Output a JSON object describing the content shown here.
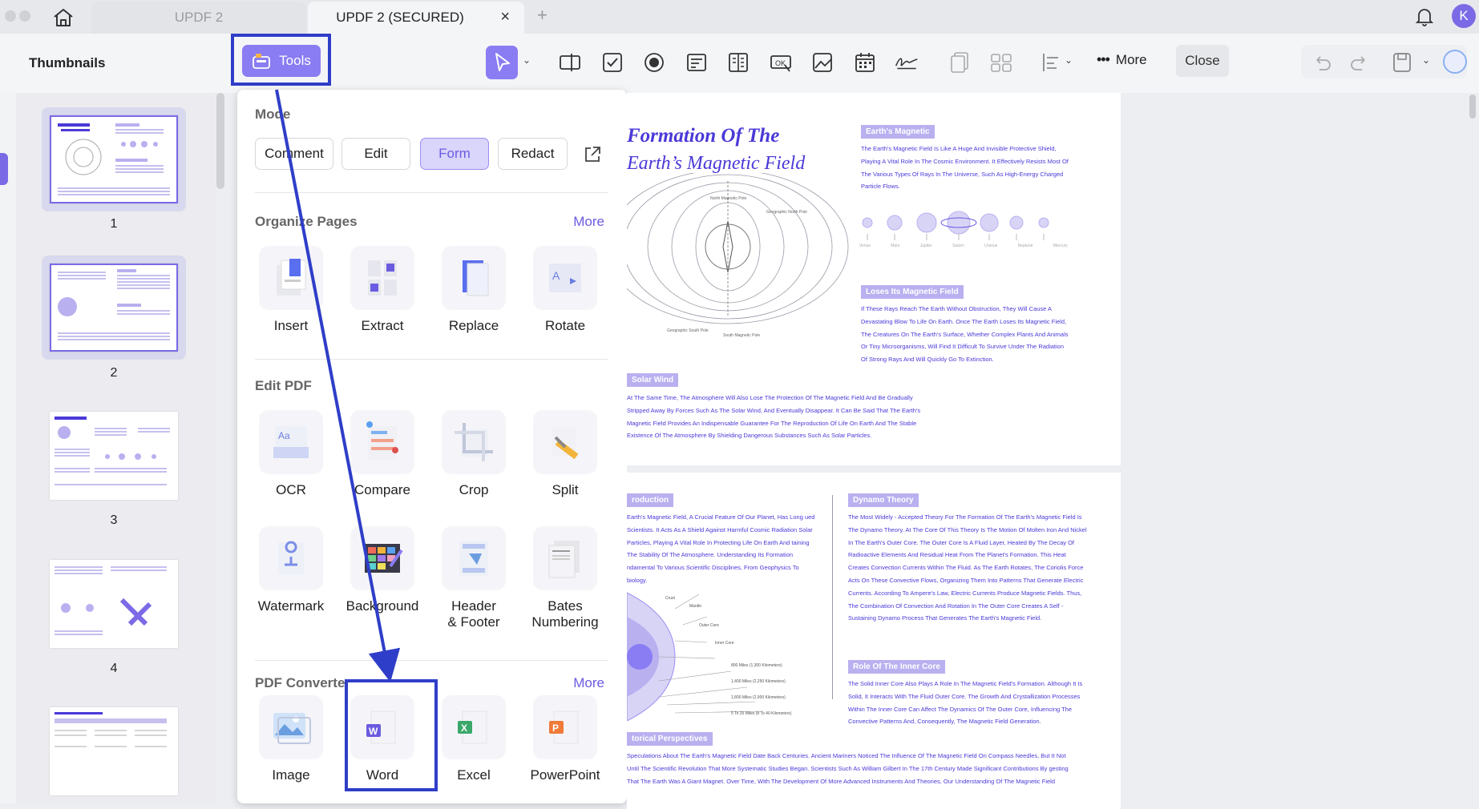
{
  "tabs": {
    "inactive": "UPDF 2",
    "active": "UPDF 2 (SECURED)",
    "close_symbol": "×",
    "new_tab_symbol": "+"
  },
  "user": {
    "initial": "K"
  },
  "sidebar": {
    "title": "Thumbnails"
  },
  "toolbar": {
    "tools_label": "Tools",
    "more_label": "More",
    "close_label": "Close"
  },
  "thumbnails": [
    {
      "page": "1",
      "selected": true
    },
    {
      "page": "2",
      "selected": true
    },
    {
      "page": "3",
      "selected": false
    },
    {
      "page": "4",
      "selected": false
    }
  ],
  "panel": {
    "mode": {
      "title": "Mode",
      "buttons": [
        "Comment",
        "Edit",
        "Form",
        "Redact"
      ],
      "active": "Form"
    },
    "organize": {
      "title": "Organize Pages",
      "more": "More",
      "items": [
        "Insert",
        "Extract",
        "Replace",
        "Rotate"
      ]
    },
    "edit": {
      "title": "Edit PDF",
      "items": [
        "OCR",
        "Compare",
        "Crop",
        "Split",
        "Watermark",
        "Background",
        "Header\n& Footer",
        "Bates\nNumbering"
      ]
    },
    "converter": {
      "title": "PDF Converter",
      "more": "More",
      "items": [
        "Image",
        "Word",
        "Excel",
        "PowerPoint"
      ]
    }
  },
  "document": {
    "page1": {
      "title_line1": "Formation Of The",
      "title_line2": "Earth’s Magnetic Field",
      "tag_magnetic": "Earth's Magnetic",
      "magnetic_text": "The Earth's Magnetic Field Is Like A Huge And Invisible Protective Shield, Playing A Vital Role In The Cosmic Environment. It Effectively Resists Most Of The Various Types Of Rays In The Universe, Such As High-Energy Charged Particle Flows.",
      "tag_loses": "Loses Its Magnetic Field",
      "loses_text": "If These Rays Reach The Earth Without Obstruction, They Will Cause A Devastating Blow To Life On Earth. Once The Earth Loses Its Magnetic Field, The Creatures On The Earth's Surface, Whether Complex Plants And Animals Or Tiny Microorganisms, Will Find It Difficult To Survive Under The Radiation Of Strong Rays And Will Quickly Go To Extinction.",
      "tag_solar": "Solar Wind",
      "solar_text": "At The Same Time, The Atmosphere Will Also Lose The Protection Of The Magnetic Field And Be Gradually Stripped Away By Forces Such As The Solar Wind, And Eventually Disappear. It Can Be Said That The Earth's Magnetic Field Provides An Indispensable Guarantee For The Reproduction Of Life On Earth And The Stable Existence Of The Atmosphere By Shielding Dangerous Substances Such As Solar Particles.",
      "diagram_labels": [
        "North Magnetic Pole",
        "Geographic North Pole",
        "Geographic South Pole",
        "South Magnetic Pole"
      ],
      "planet_labels": [
        "Venus",
        "Mars",
        "Jupiter",
        "Saturn",
        "Uranus",
        "Neptune",
        "Mercury"
      ]
    },
    "page2": {
      "tag_intro": "roduction",
      "intro_text": "Earth's Magnetic Field, A Crucial Feature Of Our Planet, Has Long ued Scientists. It Acts As A Shield Against Harmful Cosmic Radiation Solar Particles, Playing A Vital Role In Protecting Life On Earth And taining The Stability Of The Atmosphere. Understanding Its Formation ndamental To Various Scientific Disciplines, From Geophysics To biology.",
      "tag_dynamo": "Dynamo Theory",
      "dynamo_text": "The Most Widely - Accepted Theory For The Formation Of The Earth's Magnetic Field Is The Dynamo Theory. At The Core Of This Theory Is The Motion Of Molten Iron And Nickel In The Earth's Outer Core. The Outer Core Is A Fluid Layer, Heated By The Decay Of Radioactive Elements And Residual Heat From The Planet's Formation. This Heat Creates Convection Currents Within The Fluid. As The Earth Rotates, The Coriolis Force Acts On These Convective Flows, Organizing Them Into Patterns That Generate Electric Currents. According To Ampere's Law, Electric Currents Produce Magnetic Fields. Thus, The Combination Of Convection And Rotation In The Outer Core Creates A Self - Sustaining Dynamo Process That Generates The Earth's Magnetic Field.",
      "tag_inner": "Role Of The Inner Core",
      "inner_text": "The Solid Inner Core Also Plays A Role In The Magnetic Field's Formation. Although It Is Solid, It Interacts With The Fluid Outer Core. The Growth And Crystallization Processes Within The Inner Core Can Affect The Dynamics Of The Outer Core, Influencing The Convective Patterns And, Consequently, The Magnetic Field Generation.",
      "tag_hist": "torical Perspectives",
      "hist_text": "Speculations About The Earth's Magnetic Field Date Back Centuries. Ancient Mariners Noticed The Influence Of The Magnetic Field On Compass Needles, But It Not Until The Scientific Revolution That More Systematic Studies Began. Scientists Such As William Gilbert In The 17th Century Made Significant Contributions By gesting That The Earth Was A Giant Magnet. Over Time, With The Development Of More Advanced Instruments And Theories, Our Understanding Of The Magnetic Field",
      "core_labels": [
        "Crust",
        "Mantle",
        "Outer Core",
        "Inner Core",
        "800 Miles (1,300 Kilometers)",
        "1,400 Miles (2,250 Kilometers)",
        "1,800 Miles (2,900 Kilometers)",
        "5 To 25 Miles (8 To 40 Kilometers)"
      ]
    }
  },
  "colors": {
    "accent": "#8a7cf2",
    "annotation": "#2f3ec8",
    "doc_text": "#4a39d8"
  }
}
